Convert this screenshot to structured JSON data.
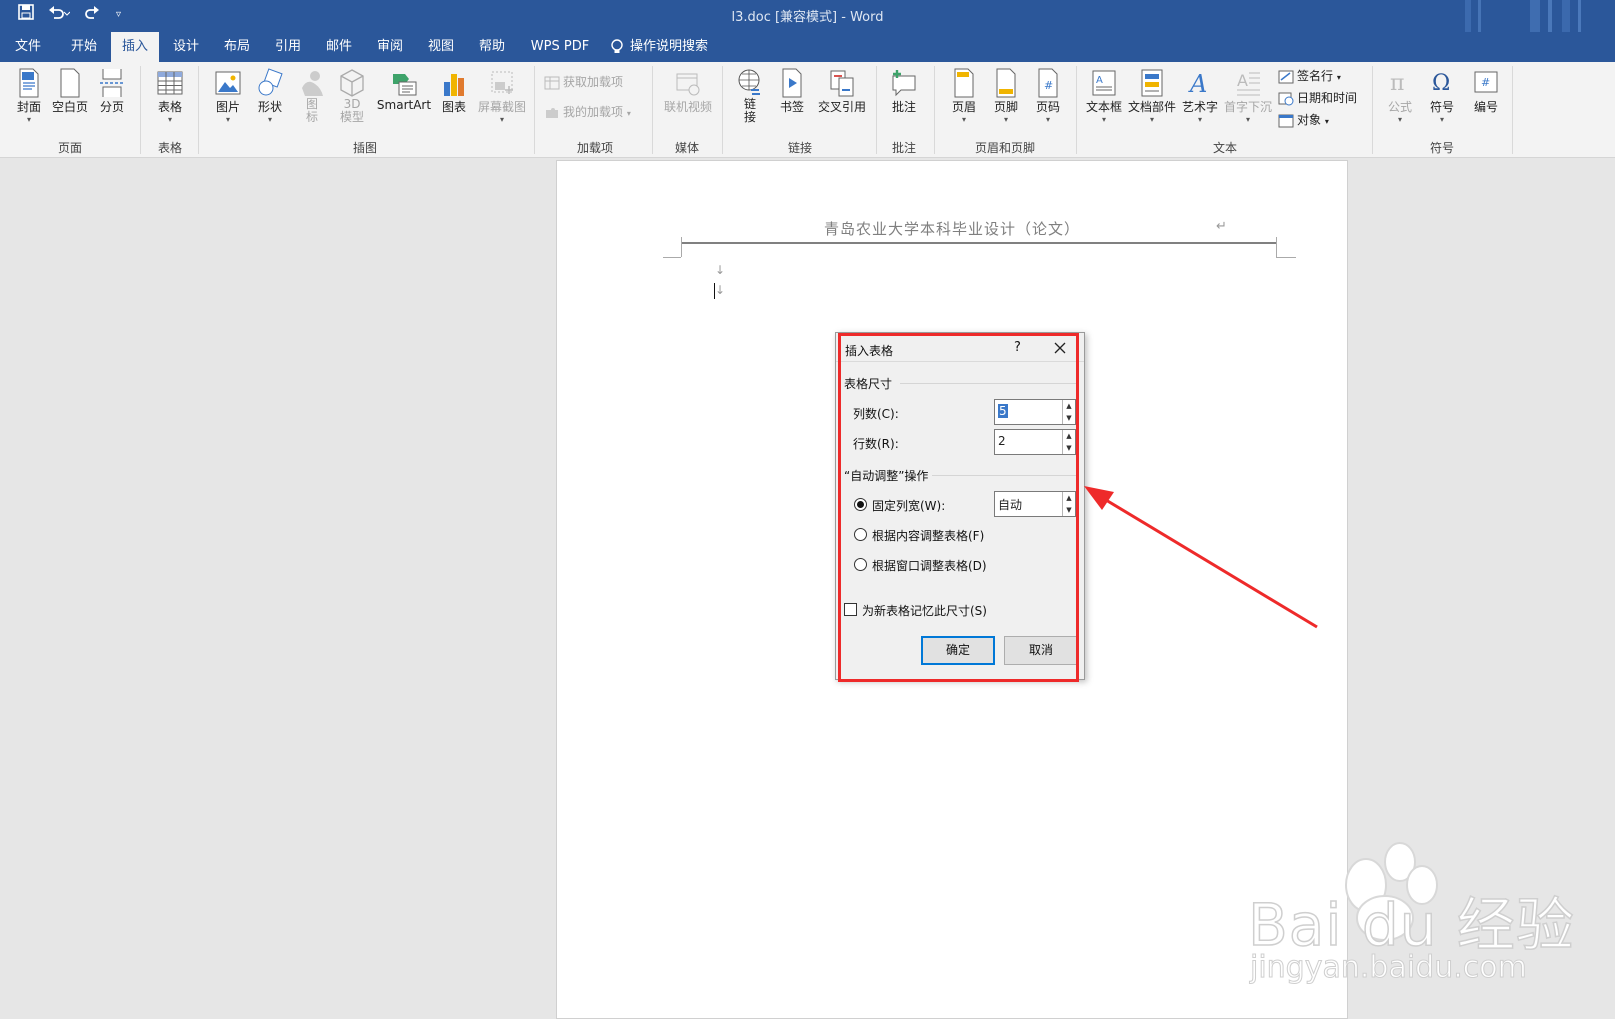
{
  "window": {
    "title": "l3.doc [兼容模式] - Word"
  },
  "qat": {
    "save_icon": "save-icon",
    "undo_icon": "undo-icon",
    "redo_icon": "redo-icon",
    "customize_icon": "customize-qat-icon"
  },
  "tabs": [
    "文件",
    "开始",
    "插入",
    "设计",
    "布局",
    "引用",
    "邮件",
    "审阅",
    "视图",
    "帮助",
    "WPS PDF"
  ],
  "tell_me": "操作说明搜索",
  "ribbon": {
    "groups": {
      "pages": "页面",
      "tables": "表格",
      "illustrations": "插图",
      "addins": "加载项",
      "media": "媒体",
      "links": "链接",
      "comments": "批注",
      "header_footer": "页眉和页脚",
      "text": "文本",
      "symbols": "符号"
    },
    "buttons": {
      "cover": "封面",
      "blank": "空白页",
      "pagebreak": "分页",
      "table": "表格",
      "picture": "图片",
      "shapes": "形状",
      "icons_1": "图",
      "icons_2": "标",
      "model_1": "3D",
      "model_2": "模型",
      "smartart": "SmartArt",
      "chart": "图表",
      "screenshot": "屏幕截图",
      "get_addins": "获取加载项",
      "my_addins": "我的加载项",
      "online_video": "联机视频",
      "link_1": "链",
      "link_2": "接",
      "bookmark": "书签",
      "crossref": "交叉引用",
      "comment": "批注",
      "header": "页眉",
      "footer": "页脚",
      "pagenum": "页码",
      "textbox": "文本框",
      "quickparts": "文档部件",
      "wordart": "艺术字",
      "dropcap": "首字下沉",
      "signature": "签名行",
      "datetime": "日期和时间",
      "object": "对象",
      "equation": "公式",
      "symbol": "符号",
      "number": "编号"
    }
  },
  "document": {
    "header_text": "青岛农业大学本科毕业设计（论文）",
    "return_mark": "↵",
    "para_mark": "↓"
  },
  "dialog": {
    "title": "插入表格",
    "help": "?",
    "size_section": "表格尺寸",
    "cols_label": "列数(C):",
    "cols_value": "5",
    "rows_label": "行数(R):",
    "rows_value": "2",
    "autofit_section": "“自动调整”操作",
    "fixed_label": "固定列宽(W):",
    "fixed_value": "自动",
    "fit_content": "根据内容调整表格(F)",
    "fit_window": "根据窗口调整表格(D)",
    "remember": "为新表格记忆此尺寸(S)",
    "ok": "确定",
    "cancel": "取消",
    "selected_option": "fixed"
  },
  "watermark": {
    "brand": "Bai du 经验",
    "url": "jingyan.baidu.com"
  },
  "colors": {
    "titlebar": "#2b579a",
    "ribbon": "#f3f3f3",
    "annotation_red": "#ee2a2a",
    "accent_blue": "#0078d7"
  }
}
